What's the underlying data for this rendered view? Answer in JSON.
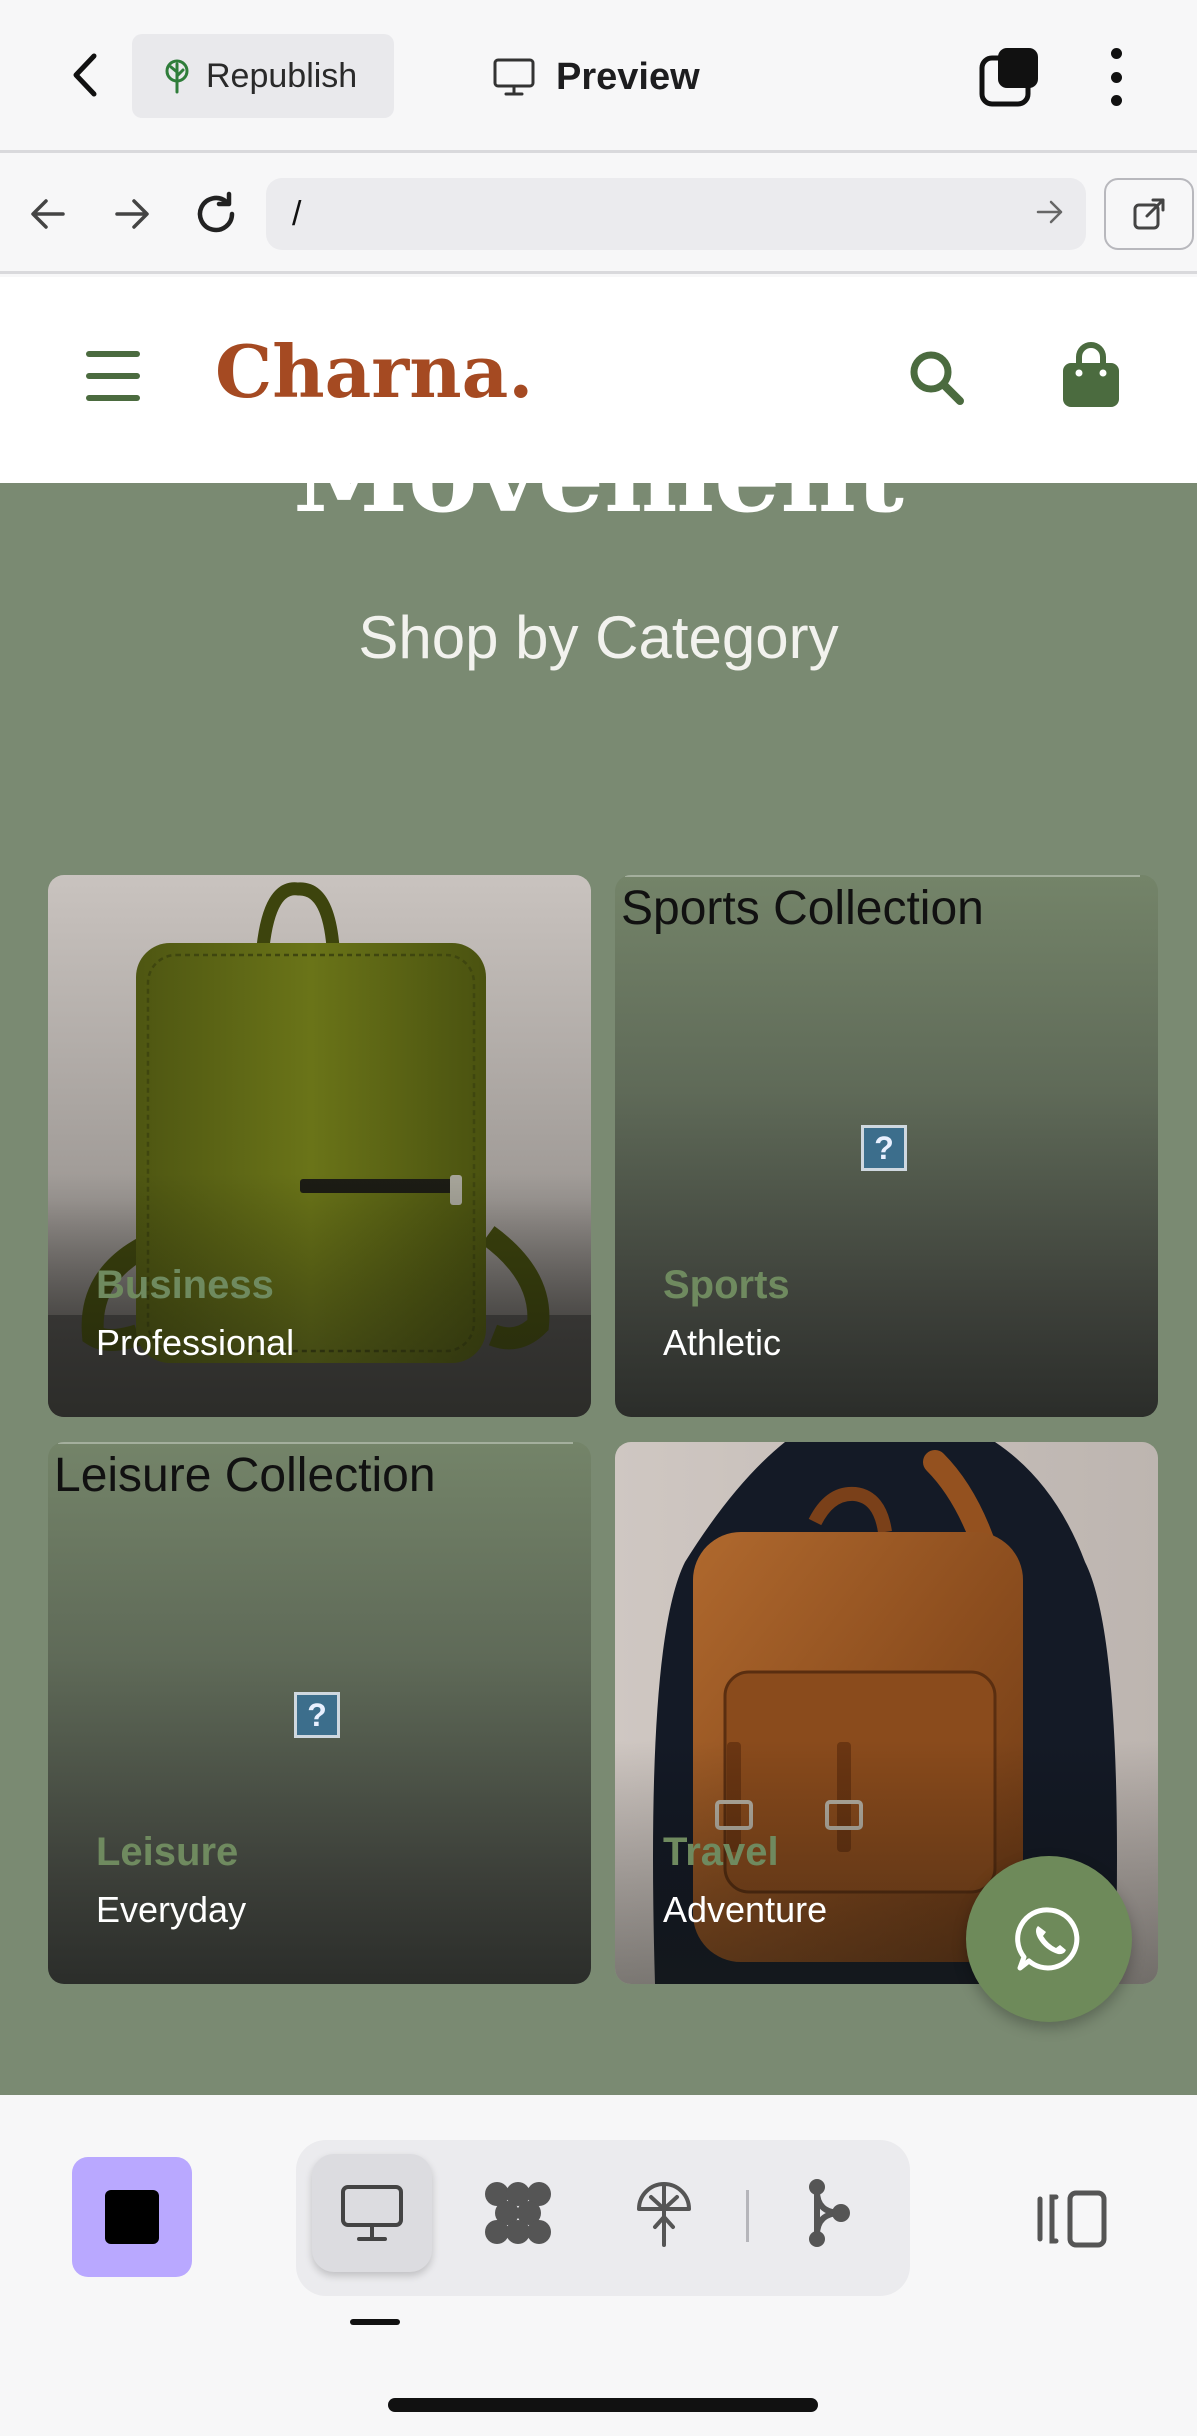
{
  "app_bar": {
    "republish_label": "Republish",
    "preview_label": "Preview"
  },
  "browser": {
    "url": "/"
  },
  "site": {
    "brand": "Charna.",
    "hero_heading": "Movement",
    "hero_subtitle": "Shop by Category",
    "categories": [
      {
        "category": "Business",
        "tagline": "Professional",
        "image_alt": "",
        "image": "olive-green-leather-backpack"
      },
      {
        "category": "Sports",
        "tagline": "Athletic",
        "image_alt": "Sports Collection",
        "image": "broken-image"
      },
      {
        "category": "Leisure",
        "tagline": "Everyday",
        "image_alt": "Leisure Collection",
        "image": "broken-image"
      },
      {
        "category": "Travel",
        "tagline": "Adventure",
        "image_alt": "",
        "image": "brown-leather-backpack-worn"
      }
    ]
  },
  "colors": {
    "brand": "#a54a22",
    "accent_green": "#4b6b3f",
    "hero_bg": "#7a8a72",
    "category_label": "#6f8a5f",
    "whatsapp_button": "#6e8a5a",
    "stop_button": "#b9a8ff"
  },
  "icons": {
    "back": "chevron-left-icon",
    "republish": "tree-icon",
    "preview": "monitor-icon",
    "copy": "copy-icon",
    "more": "more-vertical-icon",
    "nav_back": "arrow-left-icon",
    "nav_forward": "arrow-right-icon",
    "reload": "reload-icon",
    "open_external": "external-link-icon",
    "menu": "hamburger-icon",
    "search": "search-icon",
    "cart": "shopping-bag-icon",
    "whatsapp": "whatsapp-icon",
    "toolbar": [
      "stop-icon",
      "monitor-icon",
      "agents-icon",
      "publish-icon",
      "git-branch-icon",
      "panel-toggle-icon"
    ]
  }
}
